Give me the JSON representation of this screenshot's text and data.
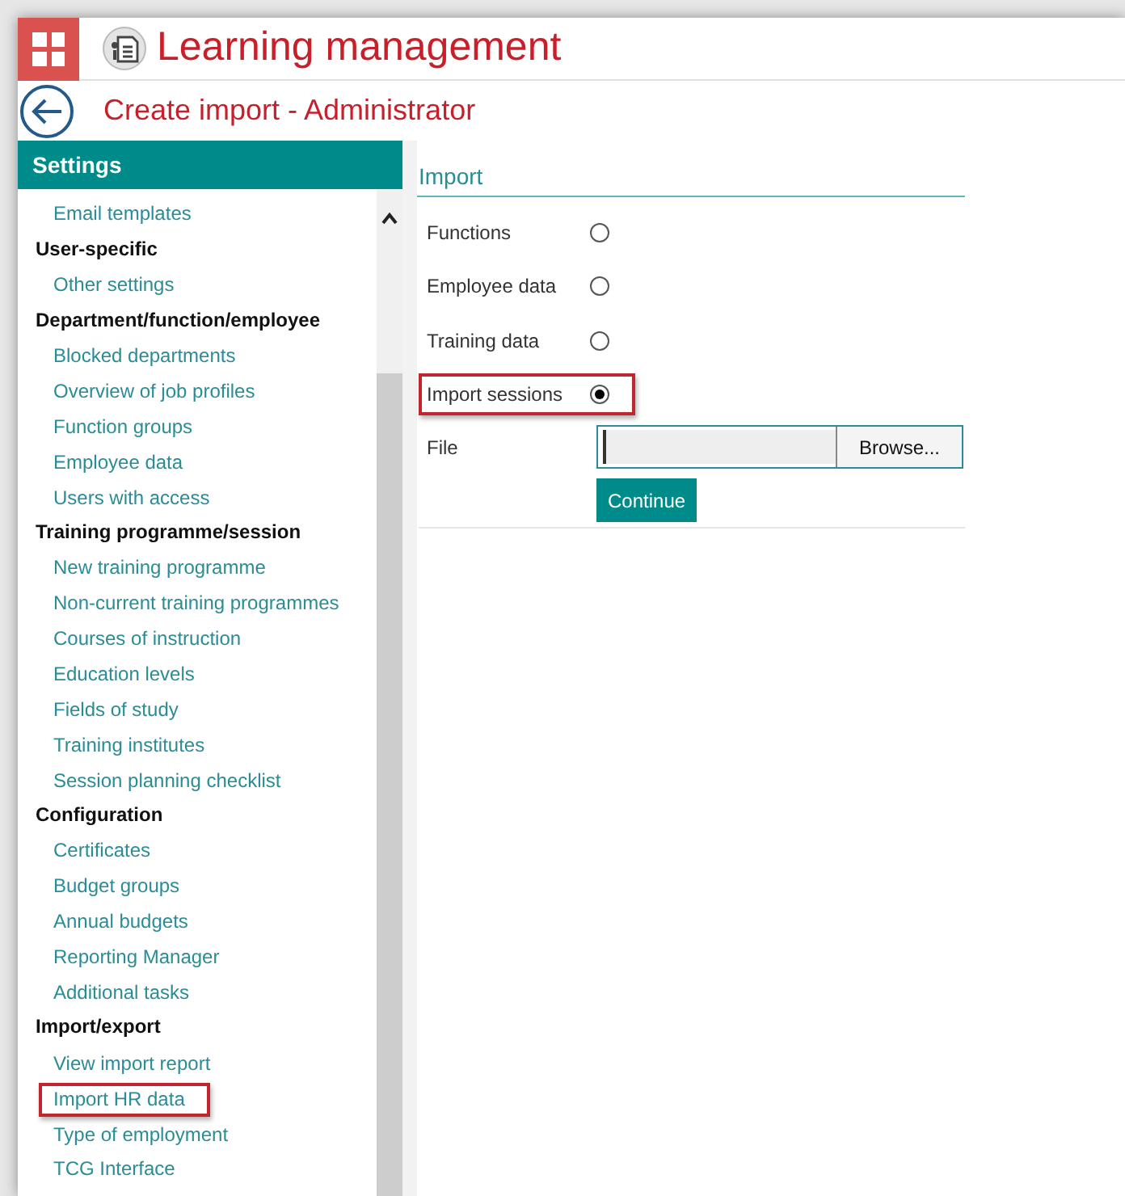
{
  "app": {
    "title": "Learning management"
  },
  "page": {
    "title": "Create import - Administrator"
  },
  "sidebar": {
    "title": "Settings",
    "items": [
      {
        "kind": "link",
        "label": "Email templates",
        "highlighted": false
      },
      {
        "kind": "heading",
        "label": "User-specific"
      },
      {
        "kind": "link",
        "label": "Other settings",
        "highlighted": false
      },
      {
        "kind": "heading",
        "label": "Department/function/employee"
      },
      {
        "kind": "link",
        "label": "Blocked departments",
        "highlighted": false
      },
      {
        "kind": "link",
        "label": "Overview of job profiles",
        "highlighted": false
      },
      {
        "kind": "link",
        "label": "Function groups",
        "highlighted": false
      },
      {
        "kind": "link",
        "label": "Employee data",
        "highlighted": false
      },
      {
        "kind": "link",
        "label": "Users with access",
        "highlighted": false
      },
      {
        "kind": "heading",
        "label": "Training programme/session"
      },
      {
        "kind": "link",
        "label": "New training programme",
        "highlighted": false
      },
      {
        "kind": "link",
        "label": "Non-current training programmes",
        "highlighted": false
      },
      {
        "kind": "link",
        "label": "Courses of instruction",
        "highlighted": false
      },
      {
        "kind": "link",
        "label": "Education levels",
        "highlighted": false
      },
      {
        "kind": "link",
        "label": "Fields of study",
        "highlighted": false
      },
      {
        "kind": "link",
        "label": "Training institutes",
        "highlighted": false
      },
      {
        "kind": "link",
        "label": "Session planning checklist",
        "highlighted": false
      },
      {
        "kind": "heading",
        "label": "Configuration"
      },
      {
        "kind": "link",
        "label": "Certificates",
        "highlighted": false
      },
      {
        "kind": "link",
        "label": "Budget groups",
        "highlighted": false
      },
      {
        "kind": "link",
        "label": "Annual budgets",
        "highlighted": false
      },
      {
        "kind": "link",
        "label": "Reporting Manager",
        "highlighted": false
      },
      {
        "kind": "link",
        "label": "Additional tasks",
        "highlighted": false
      },
      {
        "kind": "heading",
        "label": "Import/export"
      },
      {
        "kind": "link",
        "label": "View import report",
        "highlighted": false
      },
      {
        "kind": "link",
        "label": "Import HR data",
        "highlighted": true
      },
      {
        "kind": "link",
        "label": "Type of employment",
        "highlighted": false
      },
      {
        "kind": "link",
        "label": "TCG Interface",
        "highlighted": false
      }
    ]
  },
  "import": {
    "title": "Import",
    "options": [
      {
        "label": "Functions",
        "selected": false,
        "highlighted": false
      },
      {
        "label": "Employee data",
        "selected": false,
        "highlighted": false
      },
      {
        "label": "Training data",
        "selected": false,
        "highlighted": false
      },
      {
        "label": "Import sessions",
        "selected": true,
        "highlighted": true
      }
    ],
    "file_label": "File",
    "browse": "Browse...",
    "continue": "Continue"
  }
}
